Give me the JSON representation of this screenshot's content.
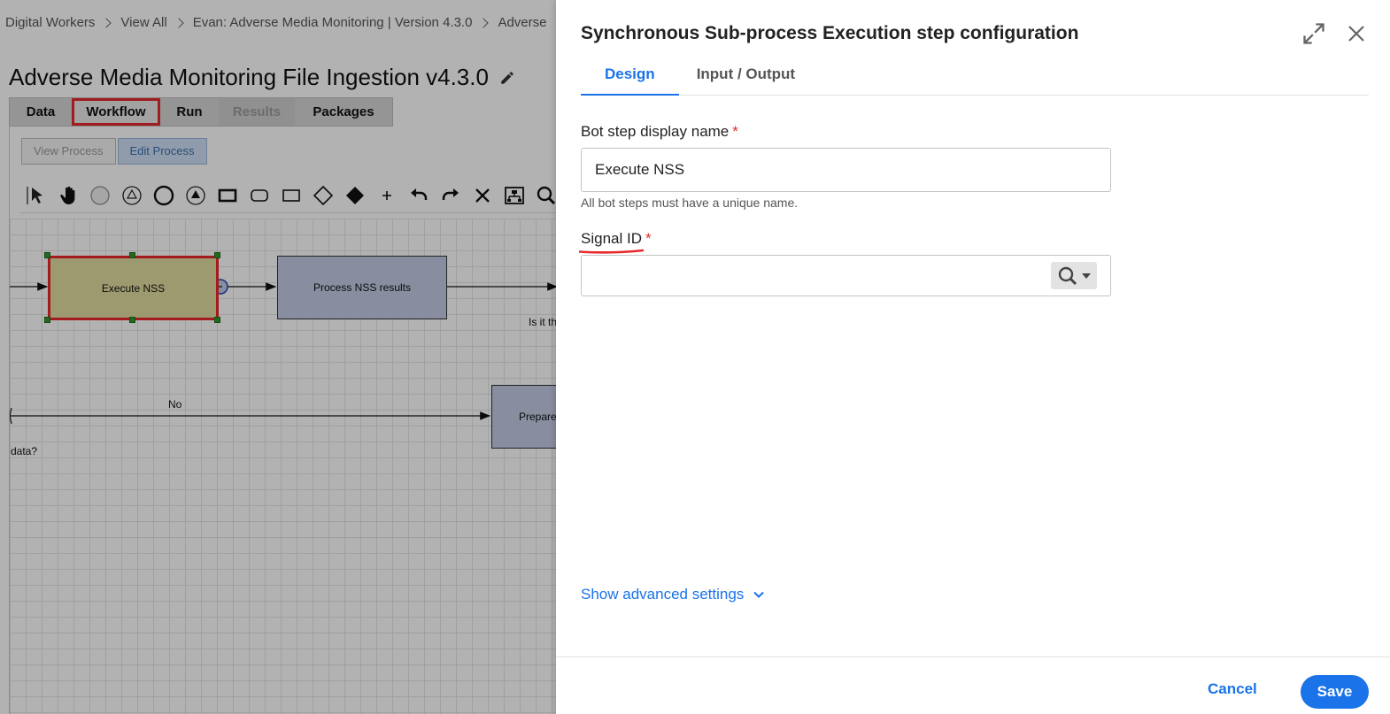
{
  "breadcrumb": [
    "Digital Workers",
    "View All",
    "Evan: Adverse Media Monitoring | Version 4.3.0",
    "Adverse"
  ],
  "page_title": "Adverse Media Monitoring File Ingestion v4.3.0",
  "app_tabs": [
    {
      "label": "Data",
      "state": "normal"
    },
    {
      "label": "Workflow",
      "state": "highlighted"
    },
    {
      "label": "Run",
      "state": "normal"
    },
    {
      "label": "Results",
      "state": "disabled"
    },
    {
      "label": "Packages",
      "state": "normal"
    }
  ],
  "process_buttons": {
    "view": "View Process",
    "edit": "Edit Process"
  },
  "toolbar_icons": [
    "pointer-icon",
    "hand-icon",
    "start-event-icon",
    "intermediate-event-icon",
    "end-event-icon",
    "signal-event-icon",
    "task-icon",
    "subprocess-icon",
    "rectangle-icon",
    "gateway-icon",
    "exclusive-gateway-icon",
    "add-icon",
    "undo-icon",
    "redo-icon",
    "delete-icon",
    "layout-icon",
    "zoom-icon"
  ],
  "diagram": {
    "nodes": {
      "execute_nss": "Execute NSS",
      "process_nss": "Process NSS results",
      "prepare": "Prepare"
    },
    "labels": {
      "is_it": "Is it th",
      "no": "No",
      "data": "data?"
    }
  },
  "panel": {
    "title": "Synchronous Sub-process Execution step configuration",
    "tabs": [
      "Design",
      "Input / Output"
    ],
    "display_name_label": "Bot step display name",
    "display_name_value": "Execute NSS",
    "display_name_help": "All bot steps must have a unique name.",
    "signal_id_label": "Signal ID",
    "signal_id_value": "",
    "required_mark": "*",
    "advanced_settings": "Show advanced settings",
    "cancel": "Cancel",
    "save": "Save"
  },
  "colors": {
    "accent": "#1a73e8",
    "highlight_red": "#e8282c",
    "selected_node": "#e2dda0",
    "node_fill": "#c3cbe6"
  }
}
